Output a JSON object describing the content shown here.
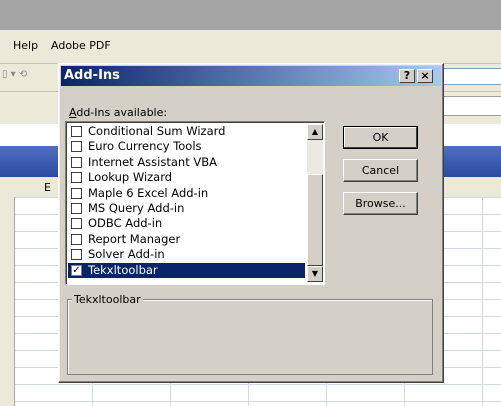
{
  "background": {
    "menu": [
      "Help",
      "Adobe PDF"
    ],
    "column_letter": "E",
    "toolbar_glyph": "▯ ▾ ⟲"
  },
  "dialog": {
    "title": "Add-Ins",
    "help_button": "?",
    "close_button": "×",
    "list_label": "Add-Ins available:",
    "items": [
      {
        "label": "Conditional Sum Wizard",
        "checked": false,
        "selected": false
      },
      {
        "label": "Euro Currency Tools",
        "checked": false,
        "selected": false
      },
      {
        "label": "Internet Assistant VBA",
        "checked": false,
        "selected": false
      },
      {
        "label": "Lookup Wizard",
        "checked": false,
        "selected": false
      },
      {
        "label": "Maple 6 Excel Add-in",
        "checked": false,
        "selected": false
      },
      {
        "label": "MS Query Add-in",
        "checked": false,
        "selected": false
      },
      {
        "label": "ODBC Add-in",
        "checked": false,
        "selected": false
      },
      {
        "label": "Report Manager",
        "checked": false,
        "selected": false
      },
      {
        "label": "Solver Add-in",
        "checked": false,
        "selected": false
      },
      {
        "label": "Tekxltoolbar",
        "checked": true,
        "selected": true
      }
    ],
    "buttons": {
      "ok": "OK",
      "cancel": "Cancel",
      "browse": "Browse..."
    },
    "description_group_label": "Tekxltoolbar",
    "scroll_up": "▲",
    "scroll_down": "▼"
  },
  "colors": {
    "selection": "#0a246a",
    "titlebar": "#0a246a",
    "dialog_bg": "#d4d0c8"
  }
}
